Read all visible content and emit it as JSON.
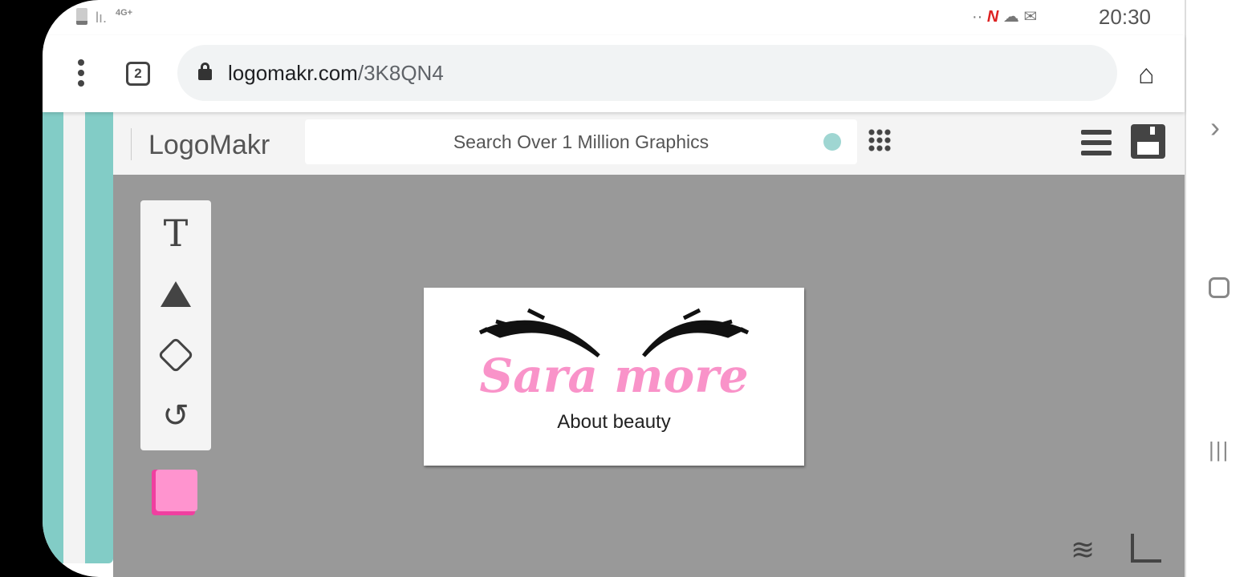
{
  "status": {
    "network": "4G+",
    "time": "20:30"
  },
  "browser": {
    "tab_count": "2",
    "url_domain": "logomakr.com",
    "url_path": "/3K8QN4"
  },
  "app": {
    "logo": "LogoMakr",
    "search_placeholder": "Search Over 1 Million Graphics"
  },
  "tools": [
    "text",
    "shape",
    "fill",
    "history"
  ],
  "colors": {
    "teal": "#82ccc6",
    "canvas": "#999999",
    "pink": "#f993c9",
    "swatch": "#ff94cf"
  },
  "design": {
    "title": "Sara more",
    "subtitle": "About beauty"
  }
}
